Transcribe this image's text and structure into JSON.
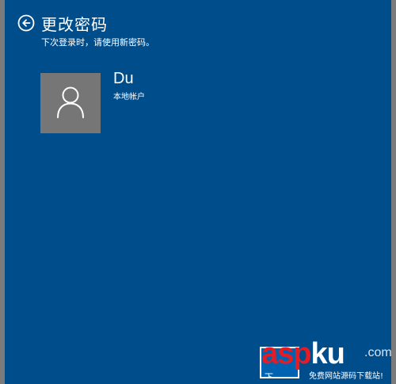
{
  "header": {
    "title": "更改密码",
    "subtitle": "下次登录时，请使用新密码。"
  },
  "account": {
    "name": "Du",
    "type": "本地帐户"
  },
  "footer": {
    "next_label": "下"
  },
  "watermark": {
    "part1": "asp",
    "part2": "ku",
    "suffix": ".com",
    "tagline": "免费网站源码下载站!"
  },
  "colors": {
    "background": "#004d8c",
    "avatar": "#767676",
    "brand_red": "#e51c23"
  }
}
